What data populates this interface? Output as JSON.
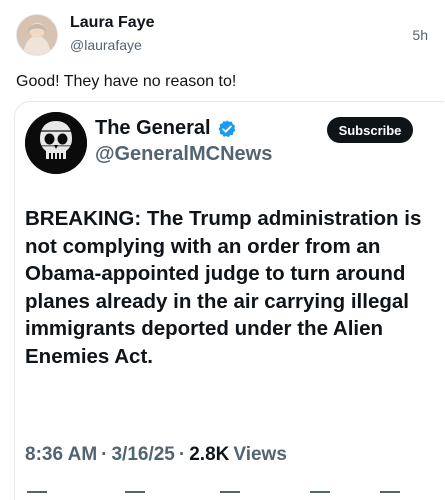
{
  "post": {
    "author_name": "Laura Faye",
    "author_handle": "@laurafaye",
    "time": "5h",
    "text": "Good! They have no reason to!"
  },
  "embed": {
    "name": "The General",
    "handle": "@GeneralMCNews",
    "subscribe_label": "Subscribe",
    "body": "BREAKING: The Trump administration is not complying with an order from an Obama-appointed judge to turn around planes already in the air carrying illegal immigrants deported under the Alien Enemies Act.",
    "time": "8:36 AM",
    "sep1": "·",
    "date": "3/16/25",
    "sep2": "·",
    "views_count": "2.8K",
    "views_label": "Views"
  },
  "icons": {
    "verified": "verified-badge-icon",
    "reply": "reply-icon",
    "repost": "repost-icon",
    "like": "like-icon",
    "bookmark": "bookmark-icon",
    "share": "share-icon"
  },
  "colors": {
    "verified": "#1d9bf0",
    "muted_text": "#536471",
    "primary_text": "#0f1419",
    "subscribe_bg": "#0f1419"
  }
}
